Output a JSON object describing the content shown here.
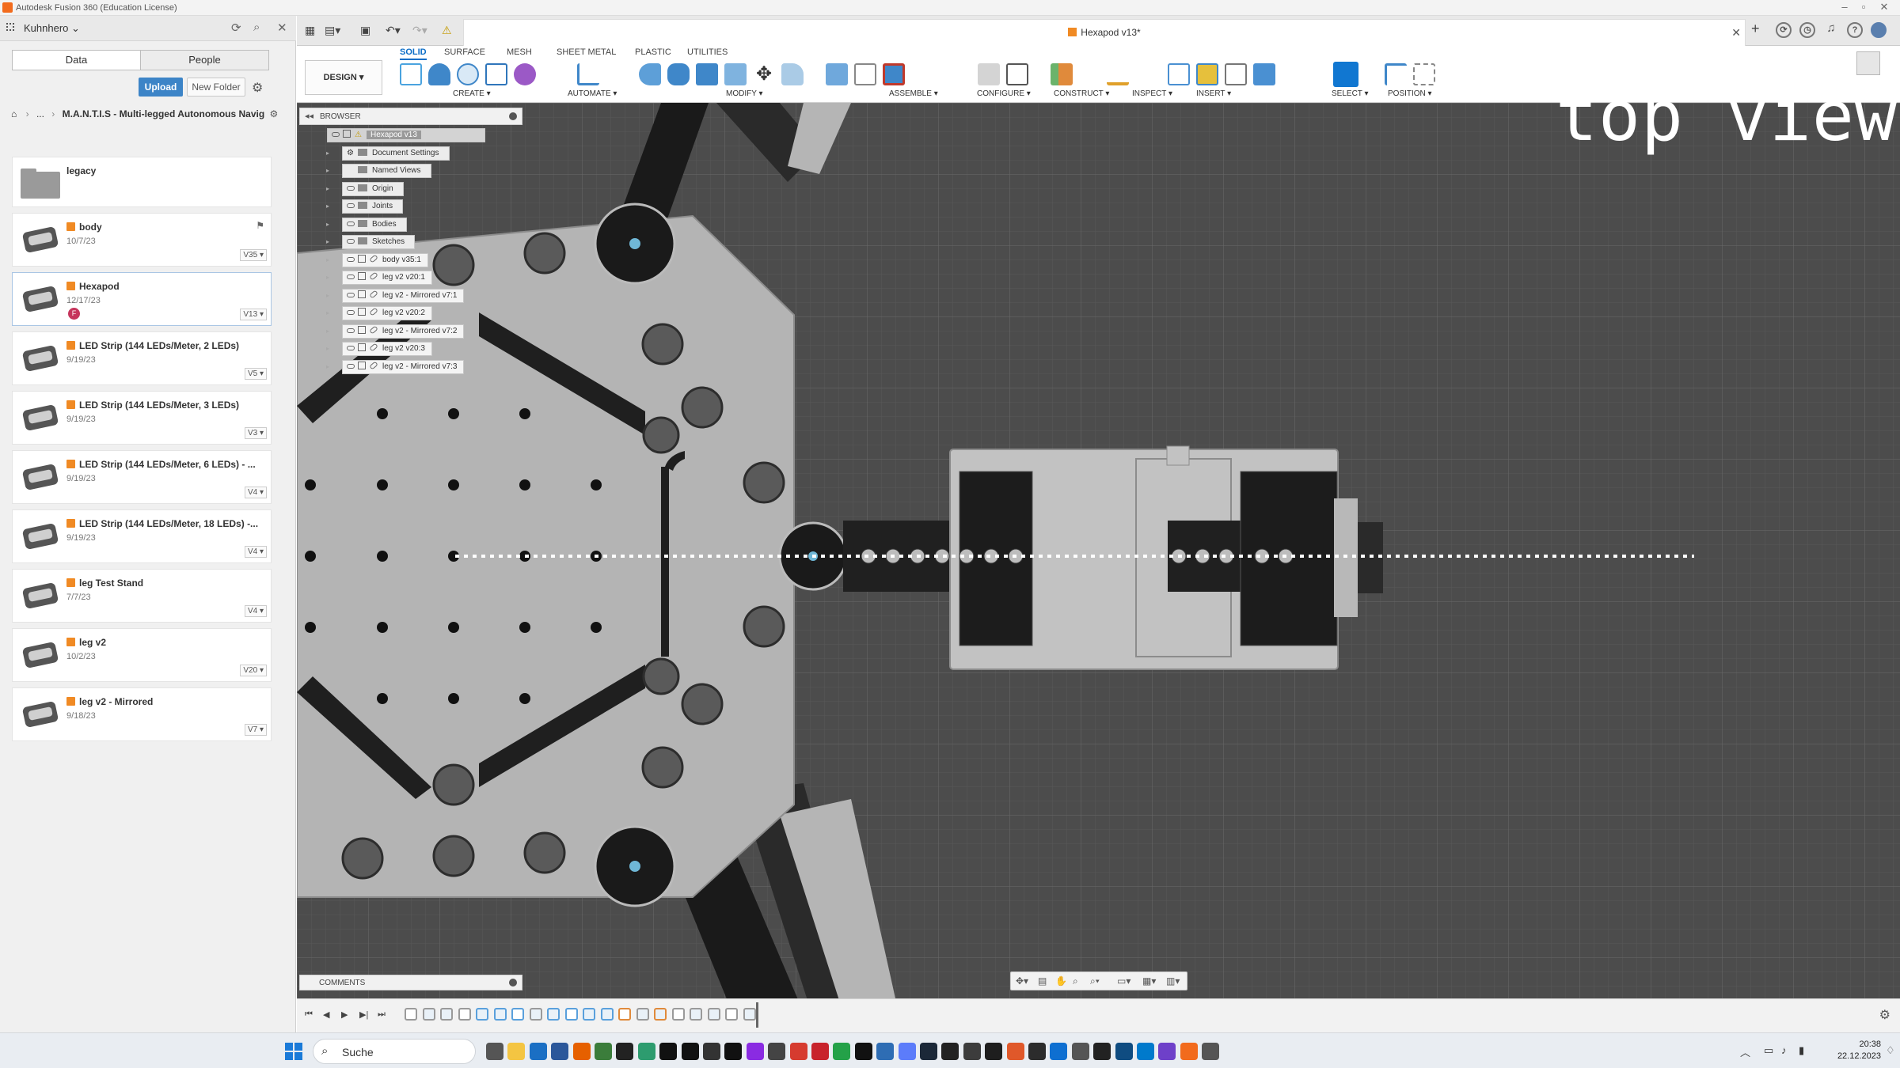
{
  "titlebar": {
    "title": "Autodesk Fusion 360 (Education License)"
  },
  "data_panel": {
    "user": "Kuhnhero",
    "tabs": [
      "Data",
      "People"
    ],
    "upload_label": "Upload",
    "new_folder_label": "New Folder",
    "breadcrumb_dots": "...",
    "breadcrumb_project": "M.A.N.T.I.S - Multi-legged Autonomous Navig",
    "files": [
      {
        "name": "legacy",
        "date": "",
        "version": "",
        "type": "folder"
      },
      {
        "name": "body",
        "date": "10/7/23",
        "version": "V35",
        "type": "design"
      },
      {
        "name": "Hexapod",
        "date": "12/17/23",
        "version": "V13",
        "type": "design",
        "user_badge": "F"
      },
      {
        "name": "LED Strip (144 LEDs/Meter, 2 LEDs)",
        "date": "9/19/23",
        "version": "V5",
        "type": "design"
      },
      {
        "name": "LED Strip (144 LEDs/Meter, 3 LEDs)",
        "date": "9/19/23",
        "version": "V3",
        "type": "design"
      },
      {
        "name": "LED Strip (144 LEDs/Meter, 6 LEDs) - ...",
        "date": "9/19/23",
        "version": "V4",
        "type": "design"
      },
      {
        "name": "LED Strip (144 LEDs/Meter, 18 LEDs) -...",
        "date": "9/19/23",
        "version": "V4",
        "type": "design"
      },
      {
        "name": "leg Test Stand",
        "date": "7/7/23",
        "version": "V4",
        "type": "design"
      },
      {
        "name": "leg v2",
        "date": "10/2/23",
        "version": "V20",
        "type": "design"
      },
      {
        "name": "leg v2 - Mirrored",
        "date": "9/18/23",
        "version": "V7",
        "type": "design"
      }
    ]
  },
  "document_tab": {
    "name": "Hexapod v13*"
  },
  "ribbon": {
    "workspace_label": "DESIGN ▾",
    "tabs": [
      "SOLID",
      "SURFACE",
      "MESH",
      "SHEET METAL",
      "PLASTIC",
      "UTILITIES"
    ],
    "active_tab": "SOLID",
    "groups": [
      "CREATE ▾",
      "AUTOMATE ▾",
      "MODIFY ▾",
      "ASSEMBLE ▾",
      "CONFIGURE ▾",
      "CONSTRUCT ▾",
      "INSPECT ▾",
      "INSERT ▾",
      "SELECT ▾",
      "POSITION ▾"
    ]
  },
  "browser": {
    "title": "BROWSER",
    "root": "Hexapod v13",
    "nodes": [
      "Document Settings",
      "Named Views",
      "Origin",
      "Joints",
      "Bodies",
      "Sketches"
    ],
    "components": [
      "body v35:1",
      "leg v2 v20:1",
      "leg v2 - Mirrored v7:1",
      "leg v2 v20:2",
      "leg v2 - Mirrored v7:2",
      "leg v2 v20:3",
      "leg v2 - Mirrored v7:3"
    ]
  },
  "viewport": {
    "annotation": "top view",
    "colors": {
      "grid_bg": "#4c4c4c",
      "plate": "#b4b4b4",
      "dark_part": "#1e1e1e"
    }
  },
  "comments": {
    "title": "COMMENTS"
  },
  "taskbar": {
    "search_label": "Suche",
    "time": "20:38",
    "date": "22.12.2023"
  }
}
